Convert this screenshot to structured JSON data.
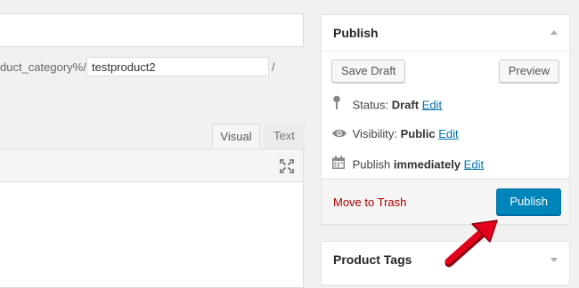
{
  "editor": {
    "permalink_prefix": "duct_category%/",
    "slug_value": "testproduct2",
    "permalink_suffix": "/",
    "tab_visual": "Visual",
    "tab_text": "Text",
    "fullscreen_icon": "fullscreen-icon"
  },
  "publish": {
    "title": "Publish",
    "save_draft": "Save Draft",
    "preview": "Preview",
    "status_label": "Status:",
    "status_value": "Draft",
    "status_edit": "Edit",
    "visibility_label": "Visibility:",
    "visibility_value": "Public",
    "visibility_edit": "Edit",
    "schedule_label": "Publish",
    "schedule_value": "immediately",
    "schedule_edit": "Edit",
    "trash": "Move to Trash",
    "publish_button": "Publish"
  },
  "tags": {
    "title": "Product Tags"
  },
  "colors": {
    "primary": "#0085ba",
    "link": "#0073aa",
    "trash": "#aa0000",
    "arrow": "#e3001b"
  }
}
